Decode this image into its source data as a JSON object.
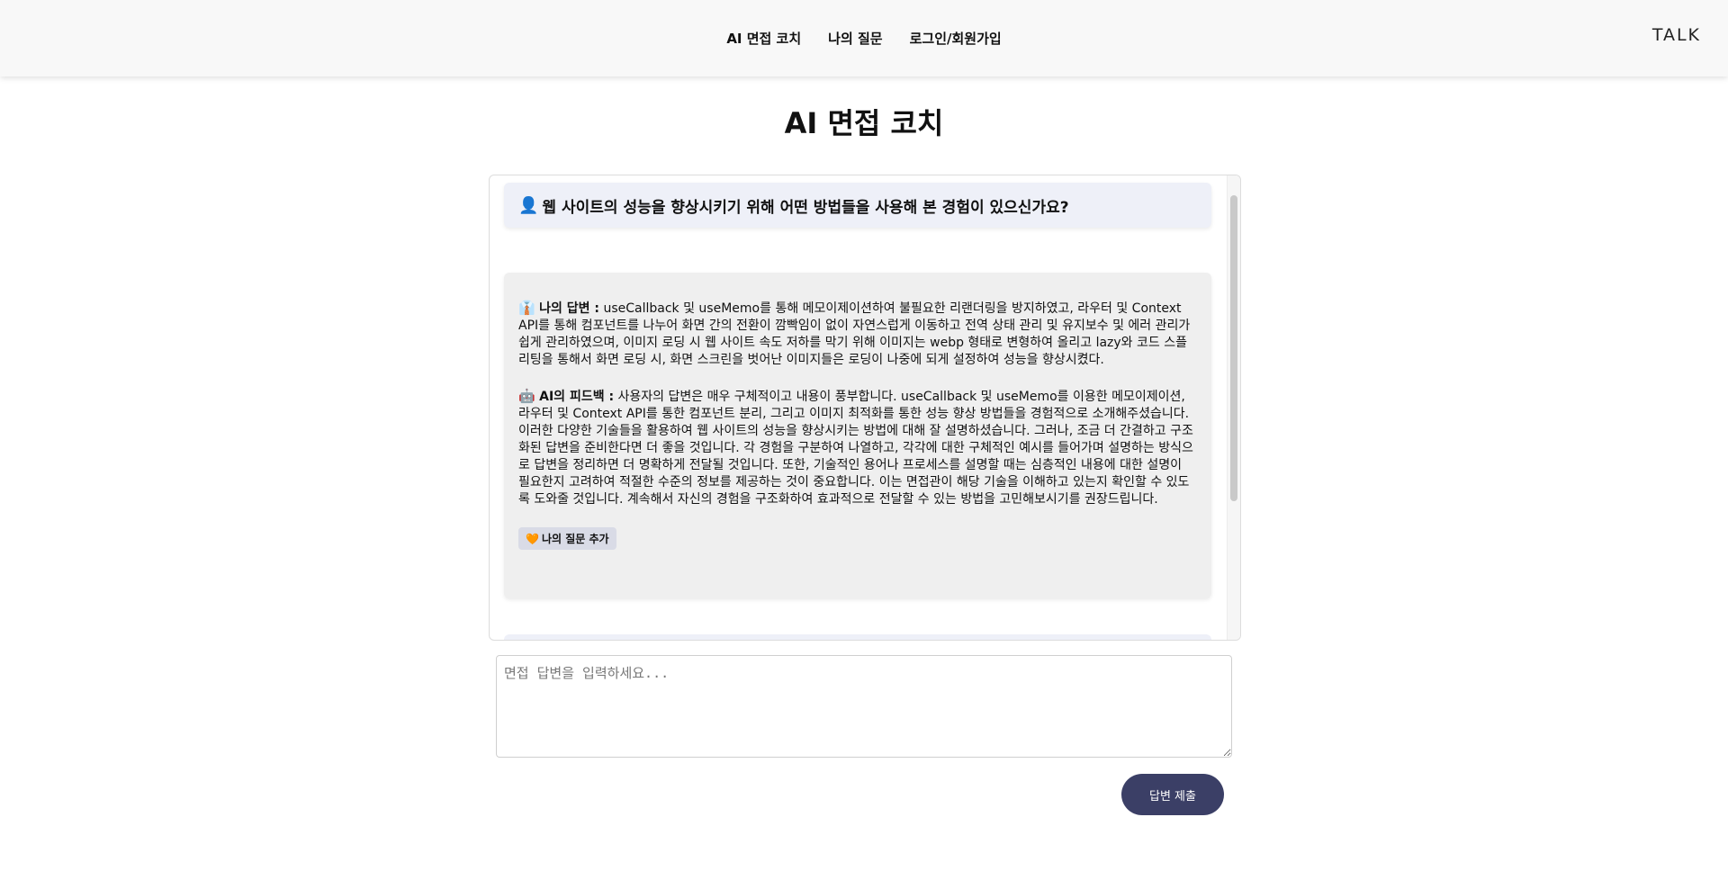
{
  "nav": {
    "links": [
      "AI 면접 코치",
      "나의 질문",
      "로그인/회원가입"
    ],
    "logo": "TALK"
  },
  "page": {
    "title": "AI 면접 코치"
  },
  "chat": {
    "question": "웹 사이트의 성능을 향상시키기 위해 어떤 방법들을 사용해 본 경험이 있으신가요?",
    "question_icon": "person-icon",
    "answer_label": "나의 답변 :",
    "answer_icon": "man-in-suit-icon",
    "answer_text": "useCallback 및 useMemo를 통해 메모이제이션하여 불필요한 리랜더링을 방지하였고, 라우터 및 Context API를 통해 컴포넌트를 나누어 화면 간의 전환이 깜빡임이 없이 자연스럽게 이동하고 전역 상태 관리 및 유지보수 및 에러 관리가 쉽게 관리하였으며, 이미지 로딩 시 웹 사이트 속도 저하를 막기 위해 이미지는 webp 형태로 변형하여 올리고 lazy와 코드 스플리팅을 통해서 화면 로딩 시, 화면 스크린을 벗어난 이미지들은 로딩이 나중에 되게 설정하여 성능을 향상시켰다.",
    "feedback_label": "AI의 피드백 :",
    "feedback_icon": "robot-icon",
    "feedback_text": "사용자의 답변은 매우 구체적이고 내용이 풍부합니다. useCallback 및 useMemo를 이용한 메모이제이션, 라우터 및 Context API를 통한 컴포넌트 분리, 그리고 이미지 최적화를 통한 성능 향상 방법들을 경험적으로 소개해주셨습니다. 이러한 다양한 기술들을 활용하여 웹 사이트의 성능을 향상시키는 방법에 대해 잘 설명하셨습니다. 그러나, 조금 더 간결하고 구조화된 답변을 준비한다면 더 좋을 것입니다. 각 경험을 구분하여 나열하고, 각각에 대한 구체적인 예시를 들어가며 설명하는 방식으로 답변을 정리하면 더 명확하게 전달될 것입니다. 또한, 기술적인 용어나 프로세스를 설명할 때는 심층적인 내용에 대한 설명이 필요한지 고려하여 적절한 수준의 정보를 제공하는 것이 중요합니다. 이는 면접관이 해당 기술을 이해하고 있는지 확인할 수 있도록 도와줄 것입니다. 계속해서 자신의 경험을 구조화하여 효과적으로 전달할 수 있는 방법을 고민해보시기를 권장드립니다.",
    "add_button_label": "나의 질문 추가",
    "add_button_icon": "orange-heart-icon"
  },
  "input": {
    "placeholder": "면접 답변을 입력하세요...",
    "value": ""
  },
  "submit": {
    "label": "답변 제출"
  },
  "colors": {
    "navbar_bg": "#f8f8f8",
    "question_bg": "#eef0f8",
    "answer_bg": "#efefef",
    "submit_bg": "#3b3f66"
  }
}
